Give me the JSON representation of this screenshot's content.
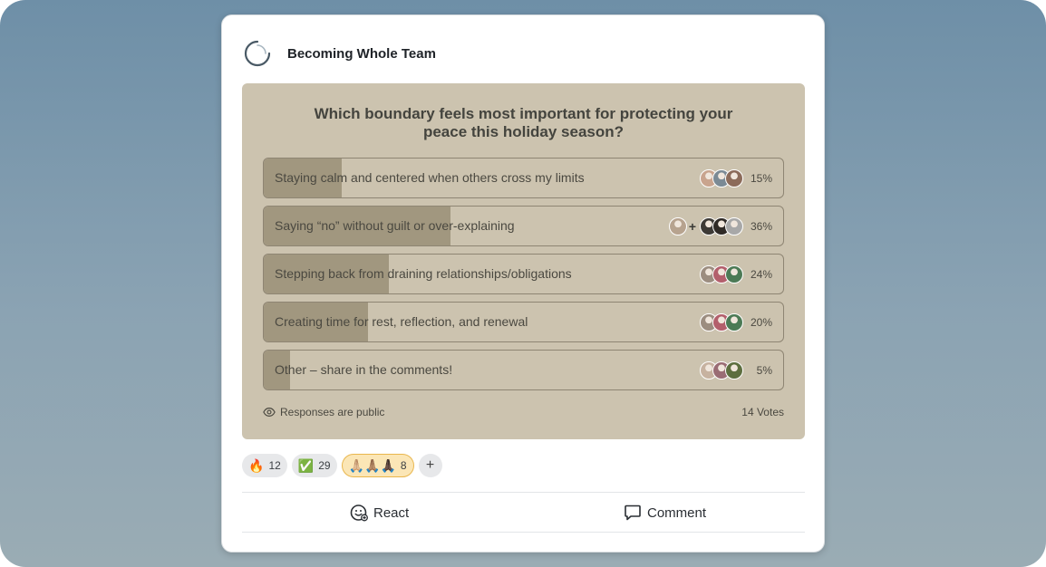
{
  "team": {
    "name": "Becoming Whole Team"
  },
  "poll": {
    "question": "Which boundary feels most important for protecting your peace this holiday season?",
    "options": [
      {
        "label": "Staying calm and centered when others cross my limits",
        "percent": 15,
        "percent_text": "15%",
        "avatars": [
          "#c9a48e",
          "#7b8a95",
          "#8c6b5a"
        ],
        "has_plus": false
      },
      {
        "label": "Saying “no” without guilt or over-explaining",
        "percent": 36,
        "percent_text": "36%",
        "avatars": [
          "#b7a38f",
          "#3d3a36",
          "#2f2a26",
          "#a8a8a8"
        ],
        "has_plus": true
      },
      {
        "label": "Stepping back from draining relationships/obligations",
        "percent": 24,
        "percent_text": "24%",
        "avatars": [
          "#9c8d80",
          "#b35f6c",
          "#4c7a55"
        ],
        "has_plus": false
      },
      {
        "label": "Creating time for rest, reflection, and renewal",
        "percent": 20,
        "percent_text": "20%",
        "avatars": [
          "#9c8d80",
          "#b35f6c",
          "#4c7a55"
        ],
        "has_plus": false
      },
      {
        "label": "Other – share in the comments!",
        "percent": 5,
        "percent_text": "5%",
        "avatars": [
          "#c7b2a0",
          "#9a6c74",
          "#5d6e3f"
        ],
        "has_plus": false
      }
    ],
    "responses_note": "Responses are public",
    "votes": "14 Votes"
  },
  "reactions": [
    {
      "emoji": "🔥",
      "icon": "fire-icon",
      "count": "12",
      "active": false
    },
    {
      "emoji": "✅",
      "icon": "check-mark-icon",
      "count": "29",
      "active": false
    },
    {
      "emoji": "🙏🏼🙏🏽🙏🏿",
      "icon": "praying-hands-icon",
      "count": "8",
      "active": true
    }
  ],
  "add_reaction_label": "+",
  "actions": {
    "react": "React",
    "comment": "Comment"
  },
  "colors": {
    "poll_bg": "#ccc3af",
    "bar_fill": "#a1977f",
    "active_reaction": "#fbe6b6"
  }
}
